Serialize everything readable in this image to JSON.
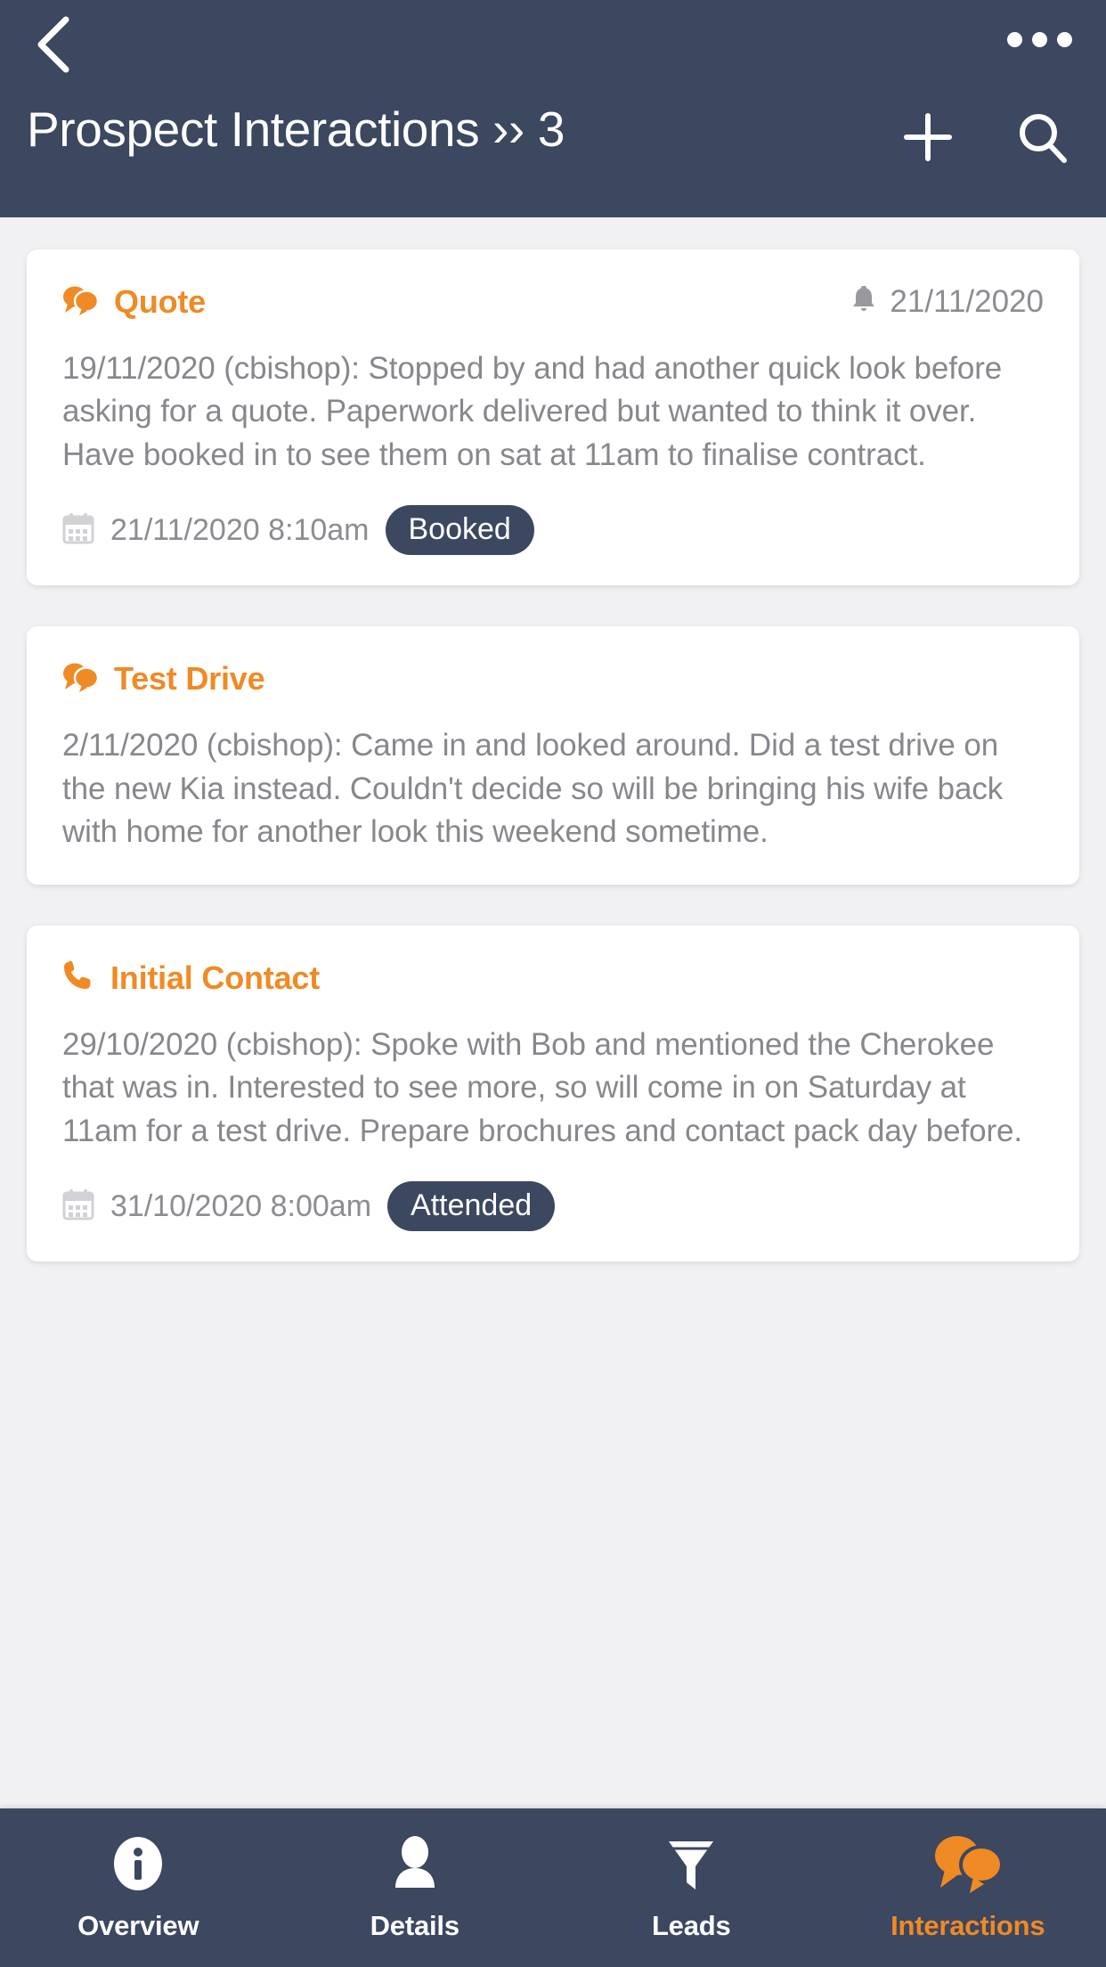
{
  "theme": {
    "navy": "#3c4760",
    "orange": "#f08a24",
    "body_text": "#87878d",
    "page_bg": "#f1f1f3",
    "card_bg": "#ffffff"
  },
  "header": {
    "back_icon": "chevron-left-icon",
    "overflow_icon": "more-options-icon",
    "title": "Prospect Interactions ›› 3",
    "add_icon": "plus-icon",
    "search_icon": "search-icon"
  },
  "interactions": [
    {
      "type_label": "Quote",
      "type_icon": "chat-bubbles-icon",
      "reminder_icon": "bell-icon",
      "reminder_date": "21/11/2020",
      "body": "19/11/2020 (cbishop): Stopped by and had another quick look before asking for a quote. Paperwork delivered but wanted to think it over. Have booked in to see them on sat at 11am to finalise contract.",
      "footer_icon": "calendar-icon",
      "footer_date": "21/11/2020 8:10am",
      "status": "Booked"
    },
    {
      "type_label": "Test Drive",
      "type_icon": "chat-bubbles-icon",
      "reminder_icon": null,
      "reminder_date": "",
      "body": "2/11/2020 (cbishop): Came in and looked around. Did a test drive on the new Kia instead. Couldn't decide so will be bringing his wife back with home for another look this weekend sometime.",
      "footer_icon": null,
      "footer_date": "",
      "status": ""
    },
    {
      "type_label": "Initial Contact",
      "type_icon": "phone-icon",
      "reminder_icon": null,
      "reminder_date": "",
      "body": "29/10/2020 (cbishop): Spoke with Bob and mentioned the Cherokee that was in. Interested to see more, so will come in on Saturday at 11am for a test drive. Prepare brochures and contact pack day before.",
      "footer_icon": "calendar-icon",
      "footer_date": "31/10/2020 8:00am",
      "status": "Attended"
    }
  ],
  "tabbar": {
    "items": [
      {
        "label": "Overview",
        "icon": "info-circle-icon",
        "active": false
      },
      {
        "label": "Details",
        "icon": "person-icon",
        "active": false
      },
      {
        "label": "Leads",
        "icon": "funnel-icon",
        "active": false
      },
      {
        "label": "Interactions",
        "icon": "chat-bubbles-icon",
        "active": true
      }
    ]
  }
}
